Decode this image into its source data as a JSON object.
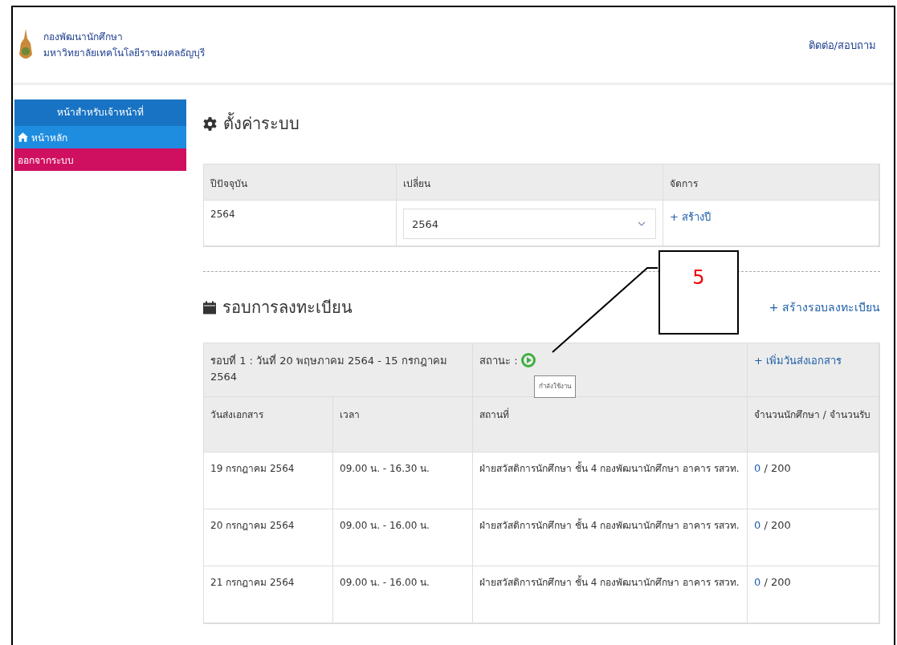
{
  "header": {
    "org_name": "กองพัฒนานักศึกษา",
    "university": "มหาวิทยาลัยเทคโนโลยีราชมงคลธัญบุรี",
    "contact_link": "ติดต่อ/สอบถาม"
  },
  "sidebar": {
    "heading": "หน้าสำหรับเจ้าหน้าที่",
    "items": [
      {
        "label": "หน้าหลัก",
        "kind": "home"
      },
      {
        "label": "ออกจากระบบ",
        "kind": "logout"
      }
    ]
  },
  "settings": {
    "title": "ตั้งค่าระบบ",
    "columns": [
      "ปีปัจจุบัน",
      "เปลี่ยน",
      "จัดการ"
    ],
    "current_year": "2564",
    "year_select": "2564",
    "create_year_link": "+ สร้างปี"
  },
  "rounds": {
    "title": "รอบการลงทะเบียน",
    "create_round_link": "+ สร้างรอบลงทะเบียน",
    "round": {
      "title": "รอบที่ 1 : วันที่ 20 พฤษภาคม 2564 - 15 กรกฎาคม 2564",
      "status_label": "สถานะ :",
      "status_active": true,
      "status_tooltip": "กำลังใช้งาน",
      "add_date_link": "+ เพิ่มวันส่งเอกสาร",
      "columns": [
        "วันส่งเอกสาร",
        "เวลา",
        "สถานที่",
        "จำนวนนักศึกษา / จำนวนรับ"
      ],
      "rows": [
        {
          "date": "19 กรกฎาคม 2564",
          "time": "09.00 น. - 16.30 น.",
          "place": "ฝ่ายสวัสดิการนักศึกษา ชั้น 4 กองพัฒนานักศึกษา อาคาร รสวท.",
          "enrolled": "0",
          "capacity": "/ 200"
        },
        {
          "date": "20 กรกฎาคม 2564",
          "time": "09.00 น. - 16.00 น.",
          "place": "ฝ่ายสวัสดิการนักศึกษา ชั้น 4 กองพัฒนานักศึกษา อาคาร รสวท.",
          "enrolled": "0",
          "capacity": "/ 200"
        },
        {
          "date": "21 กรกฎาคม 2564",
          "time": "09.00 น. - 16.00 น.",
          "place": "ฝ่ายสวัสดิการนักศึกษา ชั้น 4 กองพัฒนานักศึกษา อาคาร รสวท.",
          "enrolled": "0",
          "capacity": "/ 200"
        }
      ]
    }
  },
  "annotation": {
    "label": "5"
  }
}
